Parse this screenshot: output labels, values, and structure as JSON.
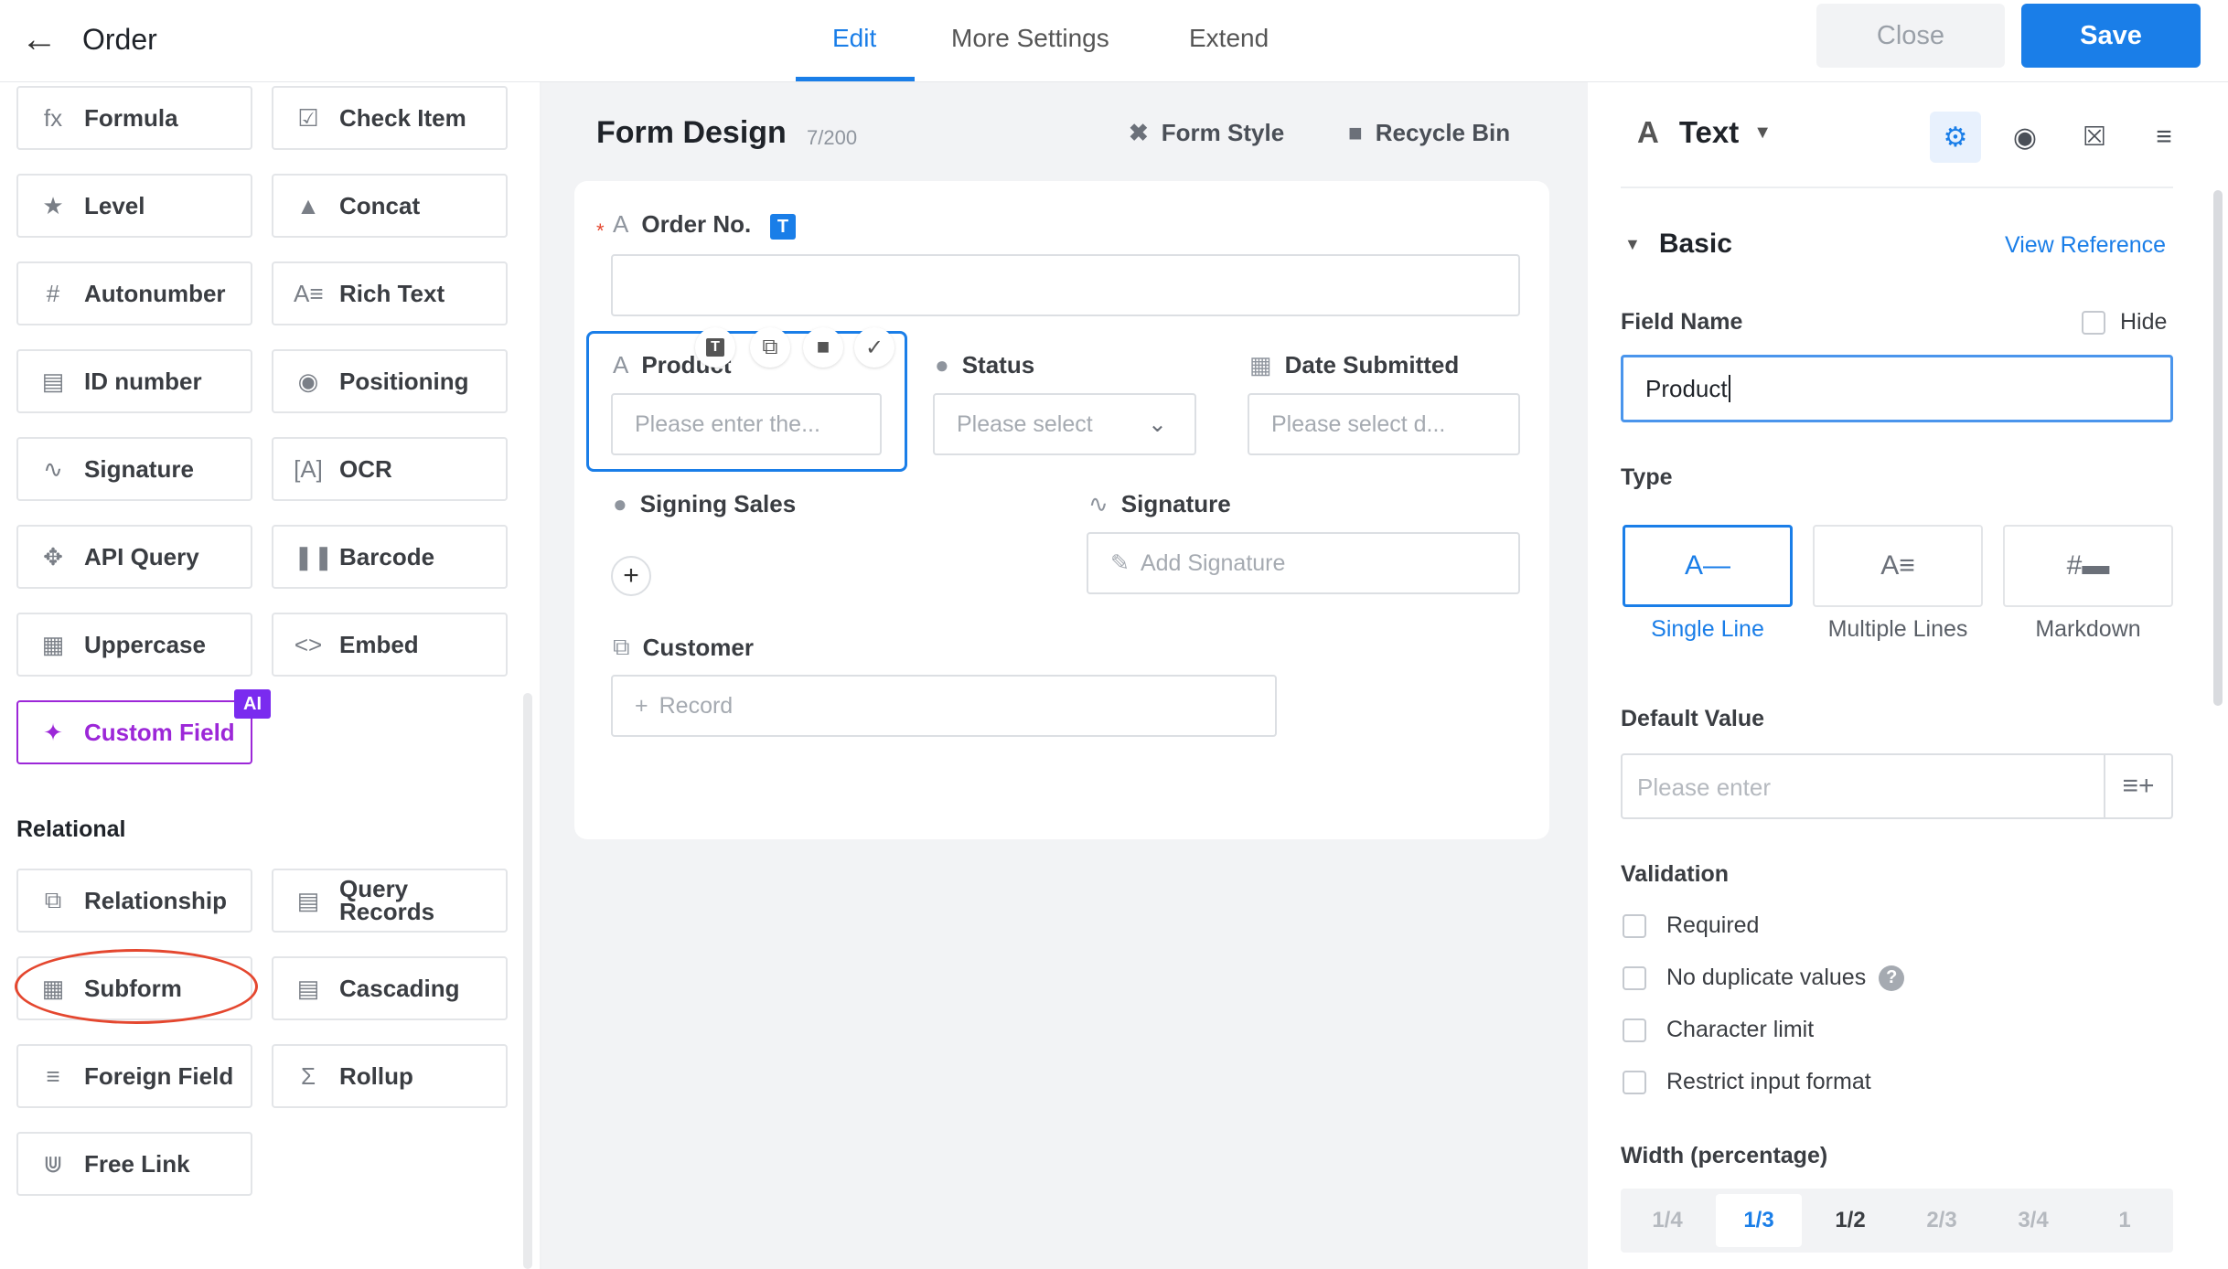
{
  "header": {
    "title": "Order",
    "tabs": [
      {
        "label": "Edit",
        "active": true
      },
      {
        "label": "More Settings",
        "active": false
      },
      {
        "label": "Extend",
        "active": false
      }
    ],
    "close_label": "Close",
    "save_label": "Save"
  },
  "left_panel": {
    "components": [
      {
        "label": "Formula",
        "icon": "fx-icon"
      },
      {
        "label": "Check Item",
        "icon": "checkbox-icon"
      },
      {
        "label": "Level",
        "icon": "star-icon"
      },
      {
        "label": "Concat",
        "icon": "shapes-icon"
      },
      {
        "label": "Autonumber",
        "icon": "hash-icon"
      },
      {
        "label": "Rich Text",
        "icon": "rich-text-icon"
      },
      {
        "label": "ID number",
        "icon": "id-card-icon"
      },
      {
        "label": "Positioning",
        "icon": "location-pin-icon"
      },
      {
        "label": "Signature",
        "icon": "signature-icon"
      },
      {
        "label": "OCR",
        "icon": "ocr-icon"
      },
      {
        "label": "API Query",
        "icon": "api-icon"
      },
      {
        "label": "Barcode",
        "icon": "barcode-icon"
      },
      {
        "label": "Uppercase",
        "icon": "uppercase-icon"
      },
      {
        "label": "Embed",
        "icon": "code-icon"
      },
      {
        "label": "Custom Field",
        "icon": "magic-wand-icon",
        "badge": "AI"
      }
    ],
    "relational_heading": "Relational",
    "relational": [
      {
        "label": "Relationship",
        "icon": "relationship-icon"
      },
      {
        "label": "Query\nRecords",
        "icon": "query-records-icon"
      },
      {
        "label": "Subform",
        "icon": "table-icon"
      },
      {
        "label": "Cascading",
        "icon": "cascading-icon"
      },
      {
        "label": "Foreign Field",
        "icon": "foreign-field-icon"
      },
      {
        "label": "Rollup",
        "icon": "sigma-icon"
      },
      {
        "label": "Free Link",
        "icon": "link-icon"
      }
    ]
  },
  "canvas": {
    "title": "Form Design",
    "count": "7/200",
    "form_style_label": "Form Style",
    "recycle_bin_label": "Recycle Bin",
    "fields": {
      "order_no": {
        "label": "Order No.",
        "badge": "T"
      },
      "product": {
        "label": "Product",
        "placeholder": "Please enter the..."
      },
      "status": {
        "label": "Status",
        "placeholder": "Please select"
      },
      "date_submitted": {
        "label": "Date Submitted",
        "placeholder": "Please select d..."
      },
      "signing_sales": {
        "label": "Signing Sales"
      },
      "signature": {
        "label": "Signature",
        "placeholder": "Add Signature"
      },
      "customer": {
        "label": "Customer",
        "placeholder": "Record"
      }
    },
    "toolbar_badge": "T"
  },
  "right_panel": {
    "type_label": "Text",
    "basic_heading": "Basic",
    "view_reference": "View Reference",
    "field_name_label": "Field Name",
    "hide_label": "Hide",
    "field_name_value": "Product",
    "type_heading": "Type",
    "types": [
      {
        "label": "Single Line",
        "active": true
      },
      {
        "label": "Multiple Lines",
        "active": false
      },
      {
        "label": "Markdown",
        "active": false
      }
    ],
    "default_value_label": "Default Value",
    "default_value_placeholder": "Please enter",
    "validation_heading": "Validation",
    "validations": [
      "Required",
      "No duplicate values",
      "Character limit",
      "Restrict input format"
    ],
    "width_heading": "Width (percentage)",
    "widths": [
      "1/4",
      "1/3",
      "1/2",
      "2/3",
      "3/4",
      "1"
    ],
    "width_selected": "1/3"
  },
  "colors": {
    "accent": "#1a7ee8",
    "ai": "#7a2bef",
    "highlight": "#e4472f"
  }
}
